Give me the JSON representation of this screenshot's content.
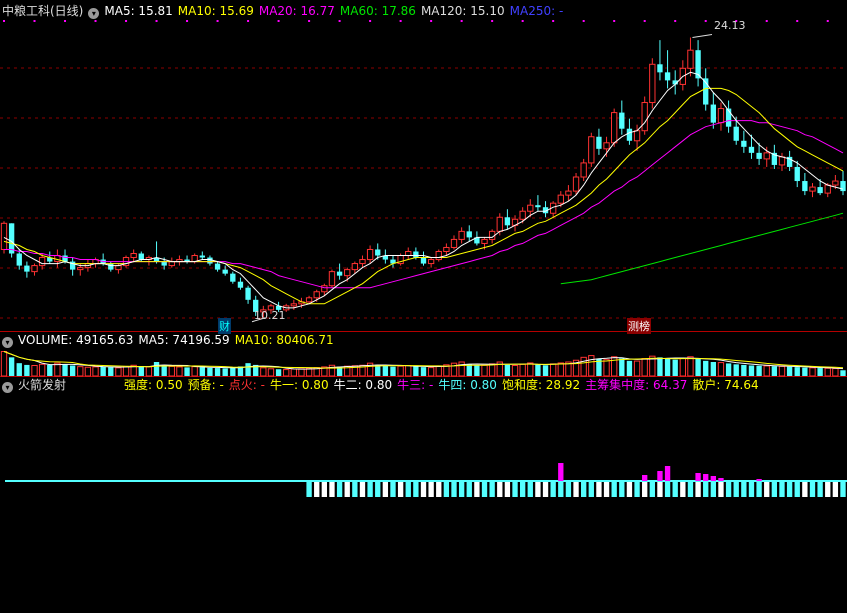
{
  "colors": {
    "up": "#ff3232",
    "down": "#54ffff",
    "ma5": "#ffffff",
    "ma10": "#ffff00",
    "ma20": "#ff00ff",
    "ma60": "#00e600",
    "ma120": "#dcdcdc",
    "ma250": "#3232ff",
    "grid": "#8b0000",
    "border": "#b40000"
  },
  "price_header": {
    "title": "中粮工科(日线)",
    "ma5": "MA5: 15.81",
    "ma10": "MA10: 15.69",
    "ma20": "MA20: 16.77",
    "ma60": "MA60: 17.86",
    "ma120": "MA120: 15.10",
    "ma250": "MA250: -"
  },
  "volume_header": {
    "volume": "VOLUME: 49165.63",
    "ma5": "MA5: 74196.59",
    "ma10": "MA10: 80406.71"
  },
  "indicator_header": {
    "name": "火箭发射",
    "items": [
      {
        "label": "强度:",
        "value": "0.50",
        "color": "#ffff00"
      },
      {
        "label": "预备:",
        "value": "-",
        "color": "#ffff00"
      },
      {
        "label": "点火:",
        "value": "-",
        "color": "#ff3232"
      },
      {
        "label": "牛一:",
        "value": "0.80",
        "color": "#ffff00"
      },
      {
        "label": "牛二:",
        "value": "0.80",
        "color": "#ffffff"
      },
      {
        "label": "牛三:",
        "value": "-",
        "color": "#ff00ff"
      },
      {
        "label": "牛四:",
        "value": "0.80",
        "color": "#54ffff"
      },
      {
        "label": "饱和度:",
        "value": "28.92",
        "color": "#ffff00"
      },
      {
        "label": "主筹集中度:",
        "value": "64.37",
        "color": "#ff00ff"
      },
      {
        "label": "散户:",
        "value": "74.64",
        "color": "#ffff00"
      }
    ]
  },
  "annotations": {
    "high_label": "24.13",
    "low_label": "10.21",
    "event_1": "财",
    "event_2": "测榜"
  },
  "chart_data": {
    "type": "candlestick",
    "ohlc_ylim": [
      9.6,
      25.0
    ],
    "high": 24.13,
    "low": 10.21,
    "candles": [
      [
        13.6,
        15.0,
        13.4,
        14.9
      ],
      [
        14.9,
        14.9,
        13.2,
        13.4
      ],
      [
        13.4,
        13.6,
        12.6,
        12.8
      ],
      [
        12.8,
        13.0,
        12.2,
        12.5
      ],
      [
        12.5,
        12.9,
        12.3,
        12.8
      ],
      [
        12.8,
        13.4,
        12.6,
        13.2
      ],
      [
        13.2,
        13.5,
        12.9,
        13.0
      ],
      [
        13.0,
        13.6,
        12.7,
        13.3
      ],
      [
        13.3,
        13.6,
        12.9,
        13.0
      ],
      [
        13.0,
        13.2,
        12.3,
        12.6
      ],
      [
        12.6,
        12.9,
        12.3,
        12.7
      ],
      [
        12.7,
        13.1,
        12.5,
        12.9
      ],
      [
        12.9,
        13.2,
        12.7,
        13.1
      ],
      [
        13.1,
        13.4,
        12.8,
        12.9
      ],
      [
        12.9,
        13.0,
        12.5,
        12.6
      ],
      [
        12.6,
        12.9,
        12.4,
        12.8
      ],
      [
        12.8,
        13.3,
        12.7,
        13.2
      ],
      [
        13.2,
        13.6,
        13.0,
        13.4
      ],
      [
        13.4,
        13.5,
        13.0,
        13.1
      ],
      [
        13.1,
        13.3,
        12.8,
        13.2
      ],
      [
        13.2,
        14.0,
        12.9,
        13.0
      ],
      [
        13.0,
        13.2,
        12.6,
        12.8
      ],
      [
        12.8,
        13.2,
        12.7,
        13.0
      ],
      [
        13.0,
        13.3,
        12.8,
        13.1
      ],
      [
        13.1,
        13.3,
        12.9,
        13.0
      ],
      [
        13.0,
        13.4,
        12.9,
        13.3
      ],
      [
        13.3,
        13.5,
        13.1,
        13.2
      ],
      [
        13.2,
        13.3,
        12.8,
        12.9
      ],
      [
        12.9,
        13.0,
        12.5,
        12.6
      ],
      [
        12.6,
        12.8,
        12.3,
        12.4
      ],
      [
        12.4,
        12.5,
        11.9,
        12.0
      ],
      [
        12.0,
        12.2,
        11.6,
        11.7
      ],
      [
        11.7,
        11.8,
        10.9,
        11.1
      ],
      [
        11.1,
        11.3,
        10.3,
        10.5
      ],
      [
        10.5,
        10.8,
        10.21,
        10.6
      ],
      [
        10.6,
        10.9,
        10.4,
        10.8
      ],
      [
        10.8,
        11.0,
        10.5,
        10.6
      ],
      [
        10.6,
        10.9,
        10.5,
        10.8
      ],
      [
        10.8,
        11.1,
        10.6,
        10.9
      ],
      [
        10.9,
        11.2,
        10.7,
        11.0
      ],
      [
        11.0,
        11.3,
        10.9,
        11.2
      ],
      [
        11.2,
        11.6,
        11.0,
        11.5
      ],
      [
        11.5,
        11.9,
        11.3,
        11.8
      ],
      [
        11.8,
        12.6,
        11.7,
        12.5
      ],
      [
        12.5,
        12.9,
        12.1,
        12.3
      ],
      [
        12.3,
        12.7,
        12.0,
        12.6
      ],
      [
        12.6,
        13.0,
        12.4,
        12.9
      ],
      [
        12.9,
        13.3,
        12.7,
        13.1
      ],
      [
        13.1,
        13.8,
        12.9,
        13.6
      ],
      [
        13.6,
        13.9,
        13.1,
        13.3
      ],
      [
        13.3,
        13.6,
        12.9,
        13.1
      ],
      [
        13.1,
        13.3,
        12.7,
        12.9
      ],
      [
        12.9,
        13.4,
        12.8,
        13.3
      ],
      [
        13.3,
        13.7,
        13.1,
        13.5
      ],
      [
        13.5,
        13.7,
        13.1,
        13.2
      ],
      [
        13.2,
        13.5,
        12.8,
        12.9
      ],
      [
        12.9,
        13.2,
        12.7,
        13.1
      ],
      [
        13.1,
        13.6,
        13.0,
        13.5
      ],
      [
        13.5,
        13.9,
        13.3,
        13.7
      ],
      [
        13.7,
        14.3,
        13.6,
        14.1
      ],
      [
        14.1,
        14.7,
        13.9,
        14.5
      ],
      [
        14.5,
        14.8,
        14.0,
        14.2
      ],
      [
        14.2,
        14.5,
        13.8,
        13.9
      ],
      [
        13.9,
        14.2,
        13.6,
        14.1
      ],
      [
        14.1,
        14.6,
        13.9,
        14.5
      ],
      [
        14.5,
        15.4,
        14.3,
        15.2
      ],
      [
        15.2,
        15.6,
        14.6,
        14.8
      ],
      [
        14.8,
        15.3,
        14.5,
        15.1
      ],
      [
        15.1,
        15.7,
        14.9,
        15.5
      ],
      [
        15.5,
        16.1,
        15.2,
        15.8
      ],
      [
        15.8,
        16.3,
        15.5,
        15.7
      ],
      [
        15.7,
        16.0,
        15.2,
        15.4
      ],
      [
        15.4,
        16.0,
        15.2,
        15.9
      ],
      [
        15.9,
        16.5,
        15.7,
        16.3
      ],
      [
        16.3,
        16.8,
        16.0,
        16.5
      ],
      [
        16.5,
        17.4,
        16.3,
        17.2
      ],
      [
        17.2,
        18.1,
        17.0,
        17.9
      ],
      [
        17.9,
        19.4,
        17.7,
        19.2
      ],
      [
        19.2,
        19.6,
        18.3,
        18.6
      ],
      [
        18.6,
        19.2,
        18.2,
        18.9
      ],
      [
        18.9,
        20.6,
        18.7,
        20.4
      ],
      [
        20.4,
        21.0,
        19.3,
        19.6
      ],
      [
        19.6,
        20.1,
        18.8,
        19.0
      ],
      [
        19.0,
        19.8,
        18.5,
        19.5
      ],
      [
        19.5,
        21.2,
        19.3,
        20.9
      ],
      [
        20.9,
        23.1,
        20.6,
        22.8
      ],
      [
        22.8,
        24.0,
        22.0,
        22.4
      ],
      [
        22.4,
        23.5,
        21.6,
        22.0
      ],
      [
        22.0,
        22.5,
        21.3,
        21.8
      ],
      [
        21.8,
        23.0,
        21.5,
        22.6
      ],
      [
        22.6,
        24.13,
        22.2,
        23.5
      ],
      [
        23.5,
        24.0,
        21.7,
        22.1
      ],
      [
        22.1,
        22.6,
        20.5,
        20.8
      ],
      [
        20.8,
        21.4,
        19.6,
        19.9
      ],
      [
        19.9,
        20.9,
        19.5,
        20.6
      ],
      [
        20.6,
        21.0,
        19.4,
        19.7
      ],
      [
        19.7,
        20.2,
        18.8,
        19.0
      ],
      [
        19.0,
        19.5,
        18.4,
        18.7
      ],
      [
        18.7,
        19.3,
        18.1,
        18.4
      ],
      [
        18.4,
        18.9,
        17.8,
        18.1
      ],
      [
        18.1,
        18.7,
        17.7,
        18.4
      ],
      [
        18.4,
        18.8,
        17.6,
        17.8
      ],
      [
        17.8,
        18.4,
        17.5,
        18.2
      ],
      [
        18.2,
        18.5,
        17.5,
        17.7
      ],
      [
        17.7,
        18.0,
        16.7,
        17.0
      ],
      [
        17.0,
        17.4,
        16.3,
        16.5
      ],
      [
        16.5,
        16.9,
        16.2,
        16.7
      ],
      [
        16.7,
        17.1,
        16.3,
        16.4
      ],
      [
        16.4,
        16.9,
        16.2,
        16.8
      ],
      [
        16.8,
        17.3,
        16.6,
        17.0
      ],
      [
        17.0,
        17.5,
        16.3,
        16.5
      ]
    ],
    "ma5": [
      14.2,
      14.0,
      13.6,
      13.3,
      13.1,
      12.9,
      12.9,
      12.9,
      13.0,
      12.9,
      12.8,
      12.8,
      12.9,
      12.9,
      12.8,
      12.8,
      12.9,
      13.0,
      13.1,
      13.1,
      13.2,
      13.1,
      13.0,
      13.0,
      13.0,
      13.0,
      13.1,
      13.1,
      13.0,
      12.9,
      12.6,
      12.4,
      12.0,
      11.6,
      11.2,
      11.0,
      10.8,
      10.7,
      10.7,
      10.8,
      10.9,
      11.1,
      11.3,
      11.6,
      11.9,
      12.1,
      12.4,
      12.7,
      12.9,
      13.2,
      13.3,
      13.3,
      13.3,
      13.3,
      13.3,
      13.3,
      13.2,
      13.2,
      13.3,
      13.5,
      13.8,
      14.0,
      14.2,
      14.2,
      14.2,
      14.5,
      14.6,
      14.8,
      15.0,
      15.3,
      15.5,
      15.5,
      15.7,
      15.8,
      16.0,
      16.3,
      16.8,
      17.4,
      17.9,
      18.4,
      18.9,
      19.2,
      19.4,
      19.5,
      19.9,
      20.5,
      21.0,
      21.5,
      21.8,
      22.2,
      22.4,
      22.3,
      21.9,
      21.4,
      21.0,
      20.5,
      20.0,
      19.6,
      19.2,
      18.8,
      18.5,
      18.3,
      18.2,
      18.1,
      17.9,
      17.6,
      17.3,
      17.0,
      16.8,
      16.7,
      16.6
    ],
    "ma10": [
      14.0,
      13.9,
      13.8,
      13.6,
      13.5,
      13.3,
      13.2,
      13.1,
      13.0,
      12.9,
      12.9,
      12.9,
      12.9,
      12.9,
      12.9,
      12.9,
      12.9,
      13.0,
      13.0,
      13.0,
      13.0,
      13.0,
      13.0,
      13.0,
      13.0,
      13.0,
      13.0,
      13.0,
      13.0,
      12.9,
      12.8,
      12.7,
      12.5,
      12.3,
      12.1,
      11.8,
      11.6,
      11.4,
      11.2,
      11.0,
      10.9,
      10.9,
      10.9,
      11.1,
      11.3,
      11.5,
      11.7,
      11.9,
      12.2,
      12.5,
      12.7,
      12.9,
      13.0,
      13.1,
      13.2,
      13.2,
      13.2,
      13.2,
      13.2,
      13.3,
      13.4,
      13.5,
      13.6,
      13.7,
      13.8,
      14.0,
      14.2,
      14.4,
      14.5,
      14.7,
      14.9,
      15.0,
      15.2,
      15.4,
      15.6,
      15.8,
      16.1,
      16.4,
      16.8,
      17.1,
      17.5,
      17.9,
      18.3,
      18.6,
      18.9,
      19.3,
      19.7,
      20.0,
      20.4,
      20.8,
      21.2,
      21.4,
      21.6,
      21.6,
      21.6,
      21.5,
      21.3,
      21.0,
      20.7,
      20.4,
      20.0,
      19.6,
      19.3,
      19.0,
      18.7,
      18.5,
      18.3,
      18.1,
      17.9,
      17.7,
      17.5
    ],
    "ma20": [
      13.6,
      13.6,
      13.5,
      13.5,
      13.4,
      13.4,
      13.3,
      13.3,
      13.2,
      13.2,
      13.1,
      13.1,
      13.1,
      13.0,
      13.0,
      13.0,
      13.0,
      13.0,
      13.0,
      13.0,
      13.0,
      13.0,
      13.0,
      13.0,
      13.0,
      13.0,
      13.0,
      13.0,
      13.0,
      13.0,
      12.9,
      12.9,
      12.8,
      12.7,
      12.6,
      12.5,
      12.3,
      12.2,
      12.1,
      12.0,
      11.9,
      11.8,
      11.7,
      11.7,
      11.7,
      11.7,
      11.7,
      11.7,
      11.7,
      11.8,
      11.9,
      12.0,
      12.1,
      12.2,
      12.3,
      12.4,
      12.5,
      12.6,
      12.7,
      12.8,
      12.9,
      13.0,
      13.1,
      13.2,
      13.3,
      13.5,
      13.6,
      13.8,
      13.9,
      14.1,
      14.3,
      14.4,
      14.6,
      14.8,
      15.0,
      15.2,
      15.4,
      15.7,
      15.9,
      16.2,
      16.5,
      16.7,
      17.0,
      17.2,
      17.5,
      17.8,
      18.1,
      18.4,
      18.7,
      19.0,
      19.3,
      19.5,
      19.7,
      19.8,
      19.9,
      20.0,
      20.0,
      20.0,
      20.0,
      19.9,
      19.9,
      19.8,
      19.7,
      19.6,
      19.5,
      19.3,
      19.2,
      19.0,
      18.8,
      18.6,
      18.4
    ],
    "ma60_start": 73,
    "ma60": [
      11.9,
      11.95,
      12.0,
      12.05,
      12.1,
      12.2,
      12.3,
      12.4,
      12.5,
      12.6,
      12.7,
      12.8,
      12.9,
      13.0,
      13.1,
      13.2,
      13.3,
      13.4,
      13.5,
      13.6,
      13.7,
      13.8,
      13.9,
      14.0,
      14.1,
      14.2,
      14.3,
      14.4,
      14.5,
      14.6,
      14.7,
      14.8,
      14.9,
      15.0,
      15.1,
      15.2,
      15.3,
      15.4
    ],
    "volume": {
      "ylim": [
        0,
        240000
      ],
      "values": [
        210000,
        160000,
        110000,
        95000,
        90000,
        100000,
        95000,
        110000,
        100000,
        90000,
        80000,
        75000,
        78000,
        82000,
        76000,
        70000,
        78000,
        92000,
        85000,
        78000,
        120000,
        95000,
        82000,
        78000,
        74000,
        80000,
        76000,
        70000,
        68000,
        65000,
        72000,
        82000,
        110000,
        95000,
        70000,
        62000,
        58000,
        55000,
        60000,
        62000,
        65000,
        72000,
        78000,
        92000,
        80000,
        84000,
        88000,
        92000,
        110000,
        96000,
        86000,
        80000,
        84000,
        90000,
        82000,
        76000,
        72000,
        86000,
        96000,
        110000,
        120000,
        100000,
        90000,
        92000,
        104000,
        120000,
        96000,
        90000,
        100000,
        112000,
        98000,
        92000,
        104000,
        112000,
        120000,
        135000,
        160000,
        175000,
        150000,
        140000,
        165000,
        150000,
        130000,
        128000,
        150000,
        170000,
        160000,
        150000,
        140000,
        150000,
        165000,
        150000,
        130000,
        120000,
        115000,
        108000,
        100000,
        95000,
        90000,
        88000,
        86000,
        84000,
        82000,
        80000,
        76000,
        72000,
        70000,
        68000,
        66000,
        64000,
        49165.63
      ],
      "ma5_last": 74196.59,
      "ma10_last": 80406.71
    },
    "indicator": {
      "baseline_color": "#54ffff",
      "bars_start_index": 40,
      "bars_pattern": [
        "c",
        "w",
        "w",
        "w",
        "c",
        "w",
        "c",
        "w",
        "c",
        "c",
        "w",
        "c",
        "w",
        "c",
        "c",
        "w",
        "w",
        "w",
        "c",
        "c",
        "c",
        "c",
        "w",
        "c",
        "c",
        "w",
        "w",
        "c",
        "c",
        "c",
        "w",
        "w",
        "c",
        "c",
        "c",
        "w",
        "c",
        "c",
        "w",
        "w",
        "c",
        "c",
        "w",
        "c",
        "w",
        "c",
        "w",
        "c",
        "c",
        "w",
        "c",
        "w",
        "c",
        "c",
        "w",
        "c",
        "c",
        "c",
        "c",
        "c",
        "w",
        "c",
        "c",
        "c",
        "c",
        "w",
        "c",
        "c",
        "w",
        "w",
        "c",
        "c"
      ],
      "magenta_spikes": [
        [
          73,
          18
        ],
        [
          84,
          6
        ],
        [
          86,
          10
        ],
        [
          87,
          15
        ],
        [
          91,
          8
        ],
        [
          92,
          7
        ],
        [
          93,
          5
        ],
        [
          94,
          3
        ],
        [
          99,
          2
        ]
      ]
    }
  }
}
